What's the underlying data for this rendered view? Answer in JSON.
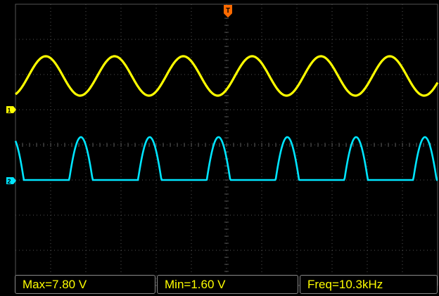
{
  "scope": {
    "background": "#000000",
    "grid_color": "#555555",
    "divisions": {
      "horizontal": 12,
      "vertical": 8
    },
    "trigger_marker": {
      "label": "T",
      "color": "#ff6a00"
    }
  },
  "channels": [
    {
      "label": "1",
      "color": "#ffff00",
      "waveform": "sine"
    },
    {
      "label": "2",
      "color": "#00e5ff",
      "waveform": "rectified-pulse"
    }
  ],
  "measurements": {
    "max": "Max=7.80 V",
    "min": "Min=1.60 V",
    "freq": "Freq=10.3kHz"
  }
}
